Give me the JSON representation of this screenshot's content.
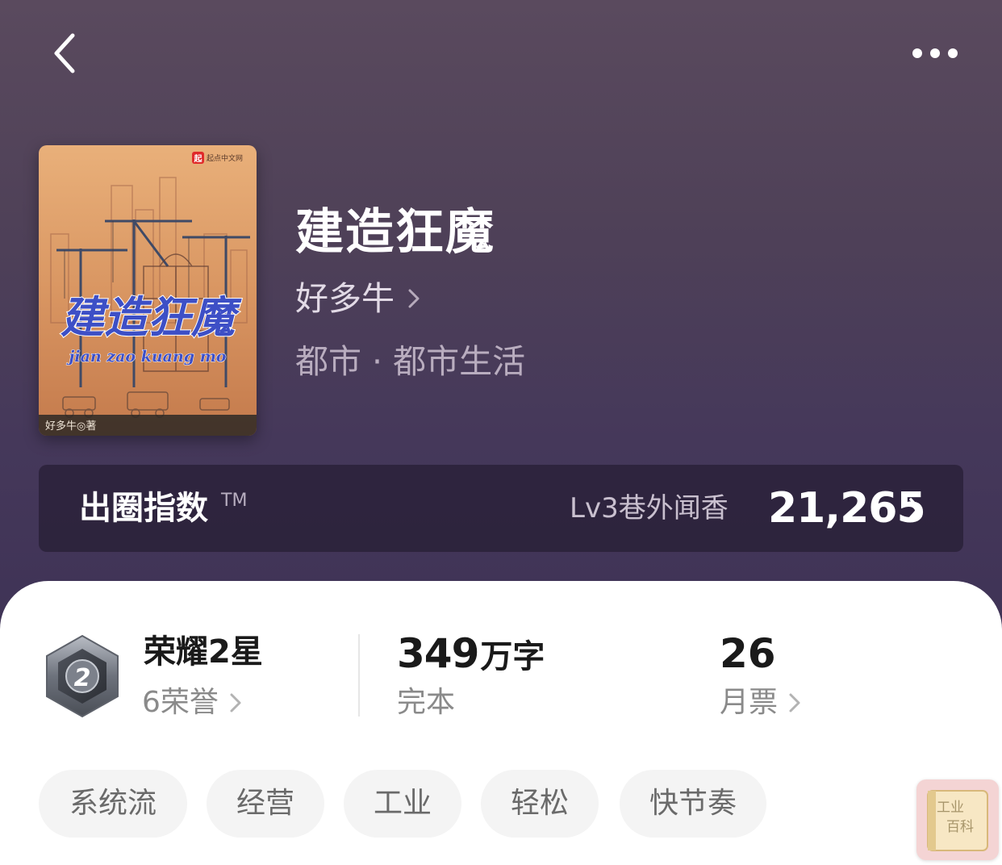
{
  "nav": {
    "back_icon": "chevron-left-icon",
    "more_icon": "more-horizontal-icon"
  },
  "book": {
    "cover": {
      "publisher_mark": "起点中文网",
      "title_art": "建造狂魔",
      "pinyin": "jian zao kuang mo",
      "author_credit": "好多牛◎著"
    },
    "title": "建造狂魔",
    "author": "好多牛",
    "genre": "都市 · 都市生活"
  },
  "index": {
    "label": "出圈指数",
    "trademark": "TM",
    "level": "Lv3巷外闻香",
    "value": "21,265"
  },
  "stats": {
    "honor": {
      "title": "荣耀2星",
      "sub": "6荣誉",
      "badge_number": "2",
      "icon": "honor-badge-icon"
    },
    "words": {
      "number": "349",
      "unit": "万字",
      "sub": "完本"
    },
    "votes": {
      "number": "26",
      "sub": "月票"
    }
  },
  "tags": [
    "系统流",
    "经营",
    "工业",
    "轻松",
    "快节奏"
  ],
  "watermark": {
    "line1": "工业",
    "line2": "百科"
  },
  "colors": {
    "hero_top": "#5a4a5e",
    "hero_bottom": "#3f3356",
    "text_dark": "#1a1a1a",
    "text_muted": "#8a8a8a",
    "tag_bg": "#f4f4f4"
  }
}
